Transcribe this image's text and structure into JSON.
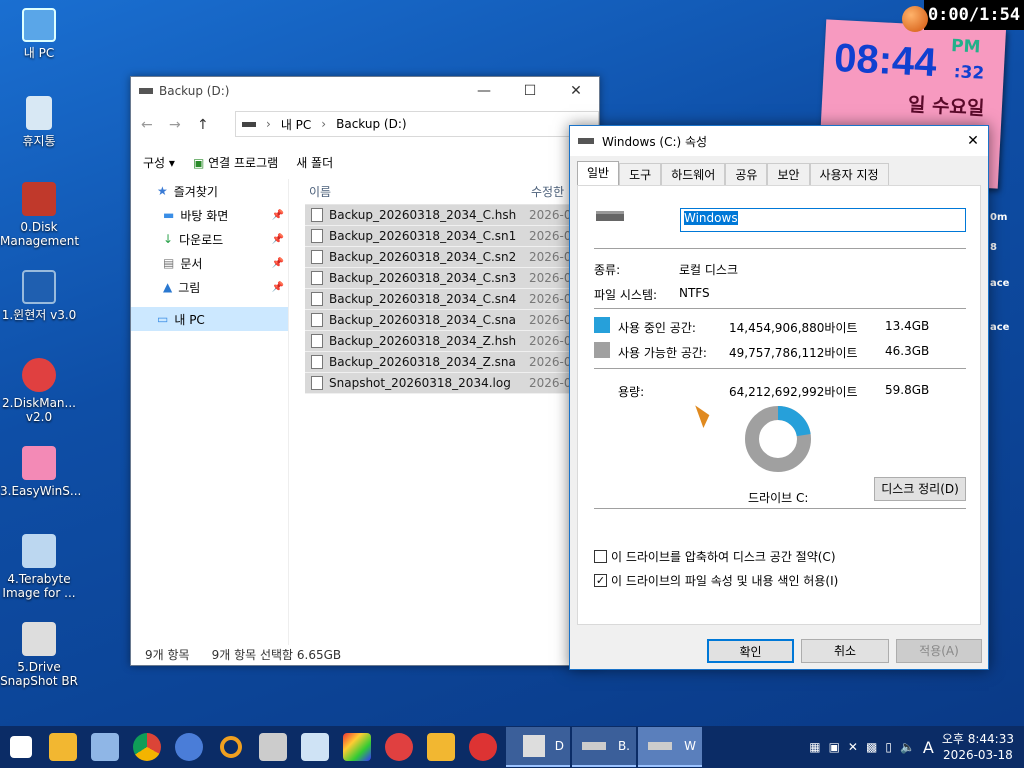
{
  "desktop": {
    "icons": [
      {
        "label": "내 PC"
      },
      {
        "label": "휴지통"
      },
      {
        "label": "0.Disk Management"
      },
      {
        "label": "1.윈현저 v3.0"
      },
      {
        "label": "2.DiskMan... v2.0"
      },
      {
        "label": "3.EasyWinS..."
      },
      {
        "label": "4.Terabyte Image for ..."
      },
      {
        "label": "5.Drive SnapShot BR"
      }
    ],
    "timer": "0:00/1:54",
    "clock_widget": {
      "time": "08:44",
      "ampm": "PM",
      "seconds": ":32",
      "day": "일 수요일"
    },
    "right_texts": [
      "0m",
      "8",
      "ace",
      "ace"
    ]
  },
  "explorer": {
    "title": "Backup (D:)",
    "breadcrumb": [
      "내 PC",
      "Backup (D:)"
    ],
    "toolbar": {
      "organize": "구성",
      "open_with": "연결 프로그램",
      "new_folder": "새 폴더"
    },
    "nav": {
      "quick_access": "즐겨찾기",
      "items": [
        {
          "label": "바탕 화면"
        },
        {
          "label": "다운로드"
        },
        {
          "label": "문서"
        },
        {
          "label": "그림"
        }
      ],
      "this_pc": "내 PC"
    },
    "columns": {
      "name": "이름",
      "modified": "수정한"
    },
    "files": [
      {
        "name": "Backup_20260318_2034_C.hsh",
        "date": "2026-0"
      },
      {
        "name": "Backup_20260318_2034_C.sn1",
        "date": "2026-0"
      },
      {
        "name": "Backup_20260318_2034_C.sn2",
        "date": "2026-0"
      },
      {
        "name": "Backup_20260318_2034_C.sn3",
        "date": "2026-0"
      },
      {
        "name": "Backup_20260318_2034_C.sn4",
        "date": "2026-0"
      },
      {
        "name": "Backup_20260318_2034_C.sna",
        "date": "2026-0"
      },
      {
        "name": "Backup_20260318_2034_Z.hsh",
        "date": "2026-0"
      },
      {
        "name": "Backup_20260318_2034_Z.sna",
        "date": "2026-0"
      },
      {
        "name": "Snapshot_20260318_2034.log",
        "date": "2026-0"
      }
    ],
    "status": {
      "count": "9개 항목",
      "selected": "9개 항목 선택함 6.65GB"
    }
  },
  "props": {
    "title": "Windows (C:) 속성",
    "tabs": [
      "일반",
      "도구",
      "하드웨어",
      "공유",
      "보안",
      "사용자 지정"
    ],
    "drive_name": "Windows",
    "type_label": "종류:",
    "type_value": "로컬 디스크",
    "fs_label": "파일 시스템:",
    "fs_value": "NTFS",
    "used_label": "사용 중인 공간:",
    "used_bytes": "14,454,906,880바이트",
    "used_gb": "13.4GB",
    "free_label": "사용 가능한 공간:",
    "free_bytes": "49,757,786,112바이트",
    "free_gb": "46.3GB",
    "cap_label": "용량:",
    "cap_bytes": "64,212,692,992바이트",
    "cap_gb": "59.8GB",
    "used_fraction": 0.225,
    "drive_caption": "드라이브 C:",
    "cleanup": "디스크 정리(D)",
    "compress": "이 드라이브를 압축하여 디스크 공간 절약(C)",
    "index": "이 드라이브의 파일 속성 및 내용 색인 허용(I)",
    "ok": "확인",
    "cancel": "취소",
    "apply": "적용(A)",
    "colors": {
      "used": "#26a0da",
      "free": "#a0a0a0"
    }
  },
  "taskbar": {
    "apps": [
      {
        "label": "D"
      },
      {
        "label": "B."
      },
      {
        "label": "W"
      }
    ],
    "ime": "A",
    "time": "오후 8:44:33",
    "date": "2026-03-18"
  }
}
